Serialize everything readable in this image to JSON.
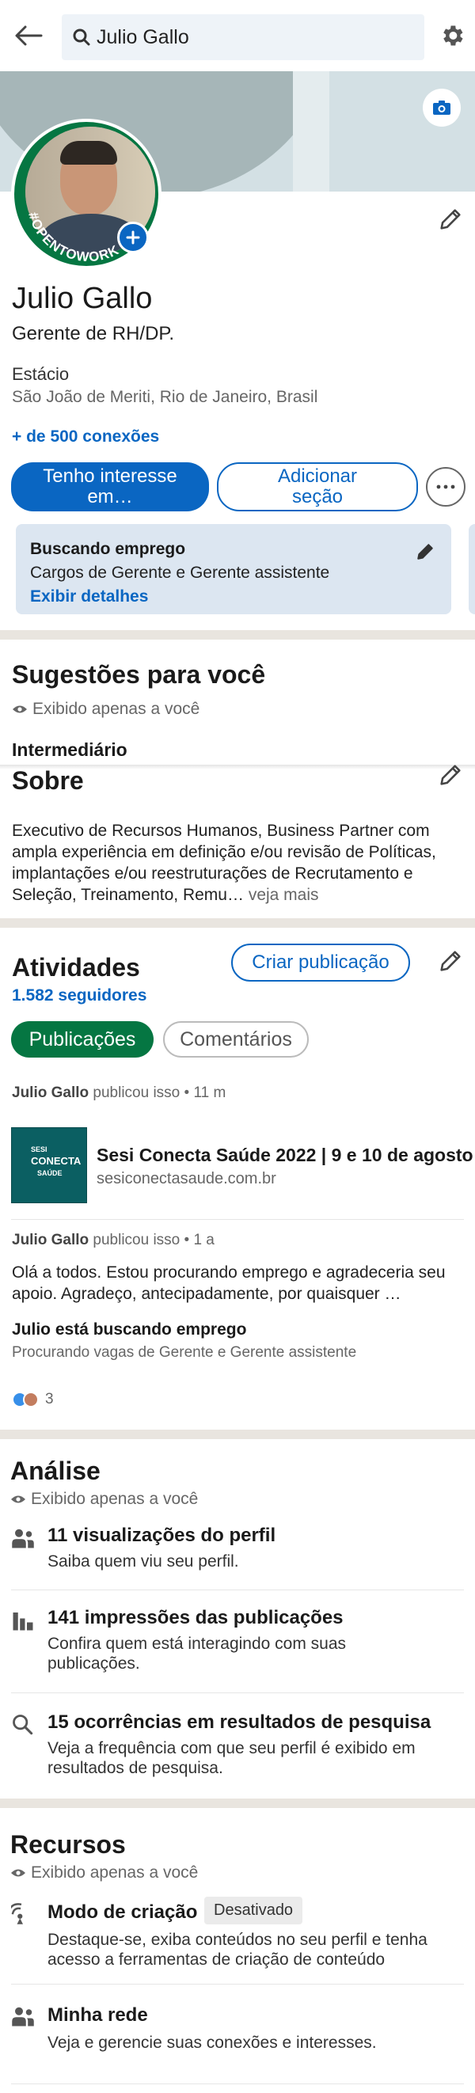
{
  "search": {
    "value": "Julio Gallo"
  },
  "profile": {
    "name": "Julio Gallo",
    "headline": "Gerente de RH/DP.",
    "education": "Estácio",
    "location": "São João de Meriti, Rio de Janeiro, Brasil",
    "connections": "+ de 500 conexões",
    "badge_text": "#OPENTOWORK"
  },
  "actions": {
    "primary_label": "Tenho interesse em…",
    "secondary_label": "Adicionar seção"
  },
  "job_search": {
    "title": "Buscando emprego",
    "subtitle": "Cargos de Gerente e Gerente assistente",
    "link": "Exibir detalhes"
  },
  "suggestions": {
    "title": "Sugestões para você",
    "visibility": "Exibido apenas a você",
    "level": "Intermediário"
  },
  "about": {
    "title": "Sobre",
    "text": "Executivo de Recursos Humanos, Business Partner com ampla experiência em definição e/ou revisão de Políticas, implantações e/ou reestruturações de Recrutamento e Seleção, Treinamento, Remu…",
    "more": "veja mais"
  },
  "activity": {
    "title": "Atividades",
    "followers": "1.582 seguidores",
    "create_post": "Criar publicação",
    "tab_posts": "Publicações",
    "tab_comments": "Comentários",
    "post1": {
      "author": "Julio Gallo",
      "action": "publicou isso",
      "time": "• 11 m",
      "link_title": "Sesi Conecta Saúde 2022 | 9 e 10 de agosto…",
      "link_domain": "sesiconectasaude.com.br",
      "thumb_line1": "SESI",
      "thumb_line2": "CONECTA",
      "thumb_line3": "SAÚDE"
    },
    "post2": {
      "author": "Julio Gallo",
      "action": "publicou isso",
      "time": "• 1 a",
      "text": "Olá a todos. Estou procurando emprego e agradeceria seu apoio. Agradeço, antecipadamente, por quaisquer …",
      "card_title": "Julio está buscando emprego",
      "card_subtitle": "Procurando vagas de Gerente e Gerente assistente",
      "reactions": "3"
    }
  },
  "analytics": {
    "title": "Análise",
    "visibility": "Exibido apenas a você",
    "items": [
      {
        "title": "11 visualizações do perfil",
        "desc": "Saiba quem viu seu perfil."
      },
      {
        "title": "141 impressões das publicações",
        "desc": "Confira quem está interagindo com suas publicações."
      },
      {
        "title": "15 ocorrências em resultados de pesquisa",
        "desc": "Veja a frequência com que seu perfil é exibido em resultados de pesquisa."
      }
    ]
  },
  "resources": {
    "title": "Recursos",
    "visibility": "Exibido apenas a você",
    "creator_title": "Modo de criação",
    "creator_status": "Desativado",
    "creator_desc": "Destaque-se, exiba conteúdos no seu perfil e tenha acesso a ferramentas de criação de conteúdo",
    "network_title": "Minha rede",
    "network_desc": "Veja e gerencie suas conexões e interesses."
  },
  "colors": {
    "brand_blue": "#0a66c2",
    "open_to_work_green": "#057642",
    "job_card_bg": "#dce6f1",
    "section_divider": "#e9e5df"
  }
}
